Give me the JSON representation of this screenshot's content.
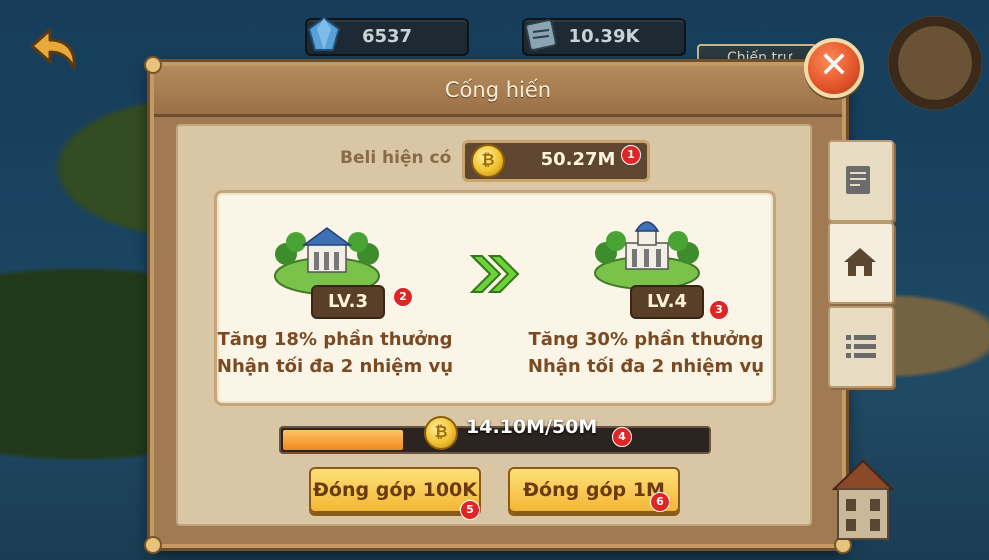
{
  "hud": {
    "gem_value": "6537",
    "scroll_value": "10.39K",
    "side_tag_label": "Chiến trư..."
  },
  "dialog": {
    "title": "Cống hiến",
    "beli_label": "Beli hiện có",
    "beli_value": "50.27M",
    "current_level": {
      "label": "LV.3",
      "line1": "Tăng 18% phần thưởng",
      "line2": "Nhận tối đa 2 nhiệm vụ"
    },
    "next_level": {
      "label": "LV.4",
      "line1": "Tăng 30% phần thưởng",
      "line2": "Nhận tối đa 2 nhiệm vụ"
    },
    "progress": {
      "text": "14.10M/50M",
      "fraction": 0.282
    },
    "buttons": {
      "donate_small": "Đóng góp 100K",
      "donate_large": "Đóng góp 1M"
    }
  },
  "badges": [
    "1",
    "2",
    "3",
    "4",
    "5",
    "6"
  ],
  "tabs": [
    "notes-icon",
    "house-icon",
    "list-icon"
  ],
  "colors": {
    "accent": "#f3b735",
    "panel": "#d8c6a4",
    "close": "#e2522a",
    "progress_fill": "#f08a1a"
  }
}
